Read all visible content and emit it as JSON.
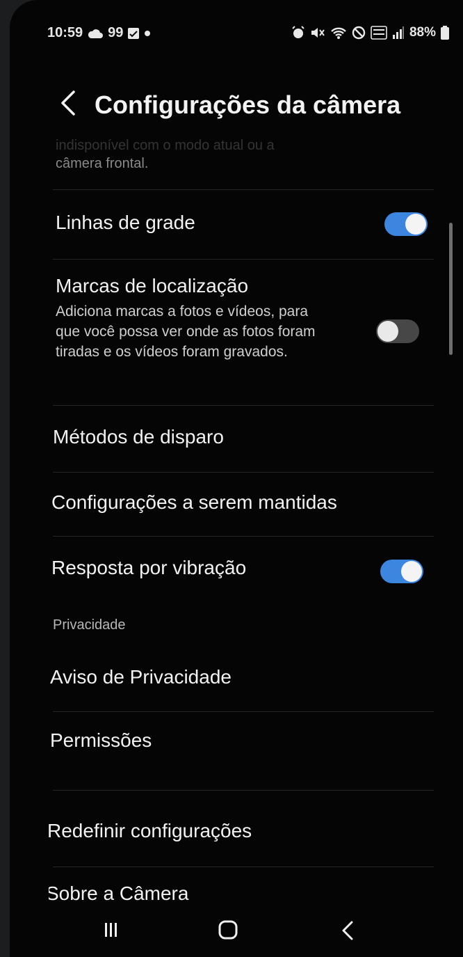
{
  "status_bar": {
    "time": "10:59",
    "notif_count": "99",
    "battery": "88%",
    "icons": [
      "cloud-icon",
      "image-icon",
      "dot-icon",
      "alarm-icon",
      "mute-icon",
      "wifi-icon",
      "dnd-icon",
      "volte-icon",
      "signal-icon",
      "battery-icon"
    ]
  },
  "header": {
    "title": "Configurações da câmera",
    "back_icon": "chevron-left-icon"
  },
  "faded_text": {
    "line1": "indisponível com o modo atual ou a",
    "line2": "câmera frontal."
  },
  "settings": {
    "grid_lines": {
      "label": "Linhas de grade",
      "enabled": true
    },
    "location_tags": {
      "label": "Marcas de localização",
      "description": "Adiciona marcas a fotos e vídeos, para que você possa ver onde as fotos foram tiradas e os vídeos foram gravados.",
      "enabled": false
    },
    "shooting_methods": {
      "label": "Métodos de disparo"
    },
    "settings_to_keep": {
      "label": "Configurações a serem mantidas"
    },
    "vibration_feedback": {
      "label": "Resposta por vibração",
      "enabled": true
    }
  },
  "privacy": {
    "header": "Privacidade",
    "privacy_notice": "Aviso de Privacidade",
    "permissions": "Permissões"
  },
  "reset": {
    "label": "Redefinir configurações"
  },
  "about": {
    "label": "Sobre a Câmera"
  },
  "colors": {
    "accent": "#3d86e0",
    "background": "#050505",
    "toggle_off": "#474747"
  },
  "nav_bar": {
    "icons": [
      "recents-icon",
      "home-icon",
      "back-icon"
    ]
  }
}
